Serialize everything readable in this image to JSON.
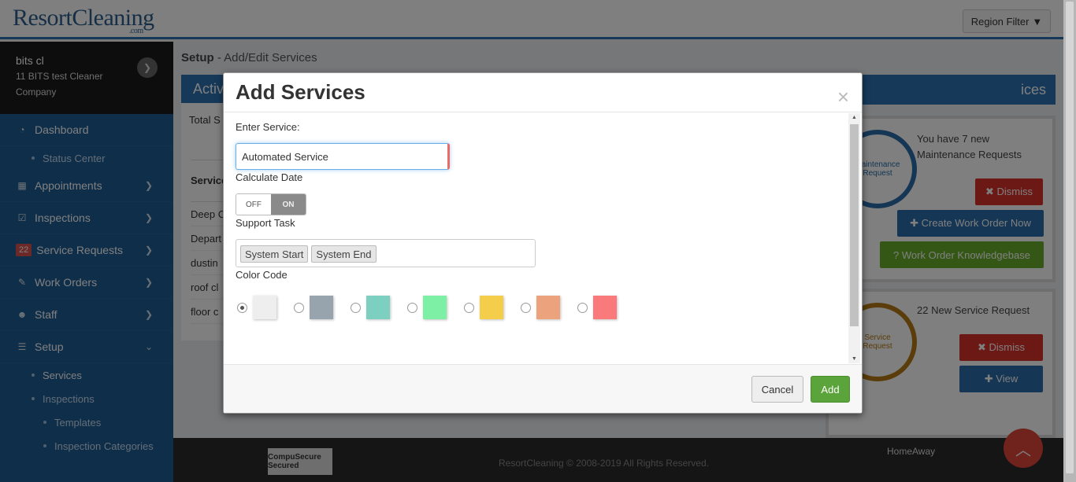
{
  "app": {
    "logo_text": "ResortCleaning",
    "logo_sub": ".com",
    "region_filter_label": "Region Filter"
  },
  "user": {
    "name": "bits cl",
    "company": "11 BITS test Cleaner Company"
  },
  "sidebar": {
    "items": [
      {
        "label": "Dashboard",
        "icon": "dashboard-icon"
      },
      {
        "label": "Status Center",
        "sub": true
      },
      {
        "label": "Appointments",
        "icon": "calendar-icon"
      },
      {
        "label": "Inspections",
        "icon": "check-square-icon"
      },
      {
        "label": "Service Requests",
        "badge": "22"
      },
      {
        "label": "Work Orders",
        "icon": "wrench-icon"
      },
      {
        "label": "Staff",
        "icon": "users-icon"
      },
      {
        "label": "Setup",
        "icon": "sliders-icon"
      },
      {
        "label": "Services",
        "sub": true
      },
      {
        "label": "Inspections",
        "sub": true
      },
      {
        "label": "Templates",
        "sub": true
      },
      {
        "label": "Inspection Categories",
        "sub": true
      }
    ]
  },
  "main": {
    "breadcrumb_strong": "Setup",
    "breadcrumb_rest": " - Add/Edit Services",
    "active_heading": "Activ",
    "total_label": "Total S",
    "table_header": "Service",
    "rows": [
      "Deep C",
      "Depart",
      "dustin",
      "roof cl",
      "floor c"
    ]
  },
  "right_panel": {
    "heading": "ices",
    "maintenance": {
      "badge_text": "Maintenance Request",
      "message": "You have 7 new Maintenance Requests",
      "dismiss": "✖ Dismiss",
      "create_work_order": "✚ Create Work Order Now",
      "knowledgebase": "? Work Order Knowledgebase"
    },
    "service": {
      "badge_text": "Service Request",
      "message": "22 New Service Request",
      "dismiss": "✖ Dismiss",
      "view": "✚ View"
    }
  },
  "footer": {
    "copyright": "ResortCleaning © 2008-2019 All Rights Reserved.",
    "secured": "CompuSecure Secured",
    "homeaway": "HomeAway"
  },
  "modal": {
    "title": "Add Services",
    "close": "×",
    "service_label": "Enter Service:",
    "service_value": "Automated Service",
    "calculate_label": "Calculate Date",
    "toggle_off": "OFF",
    "toggle_on": "ON",
    "toggle_state": "on",
    "support_label": "Support Task",
    "support_tags": [
      "System Start",
      "System End"
    ],
    "color_label": "Color Code",
    "colors": [
      "#eeeeee",
      "#98a4ad",
      "#7dcfc0",
      "#7ef0a5",
      "#f4cd4b",
      "#eca27d",
      "#fa7a7c"
    ],
    "selected_color_index": 0,
    "cancel": "Cancel",
    "add": "Add"
  }
}
